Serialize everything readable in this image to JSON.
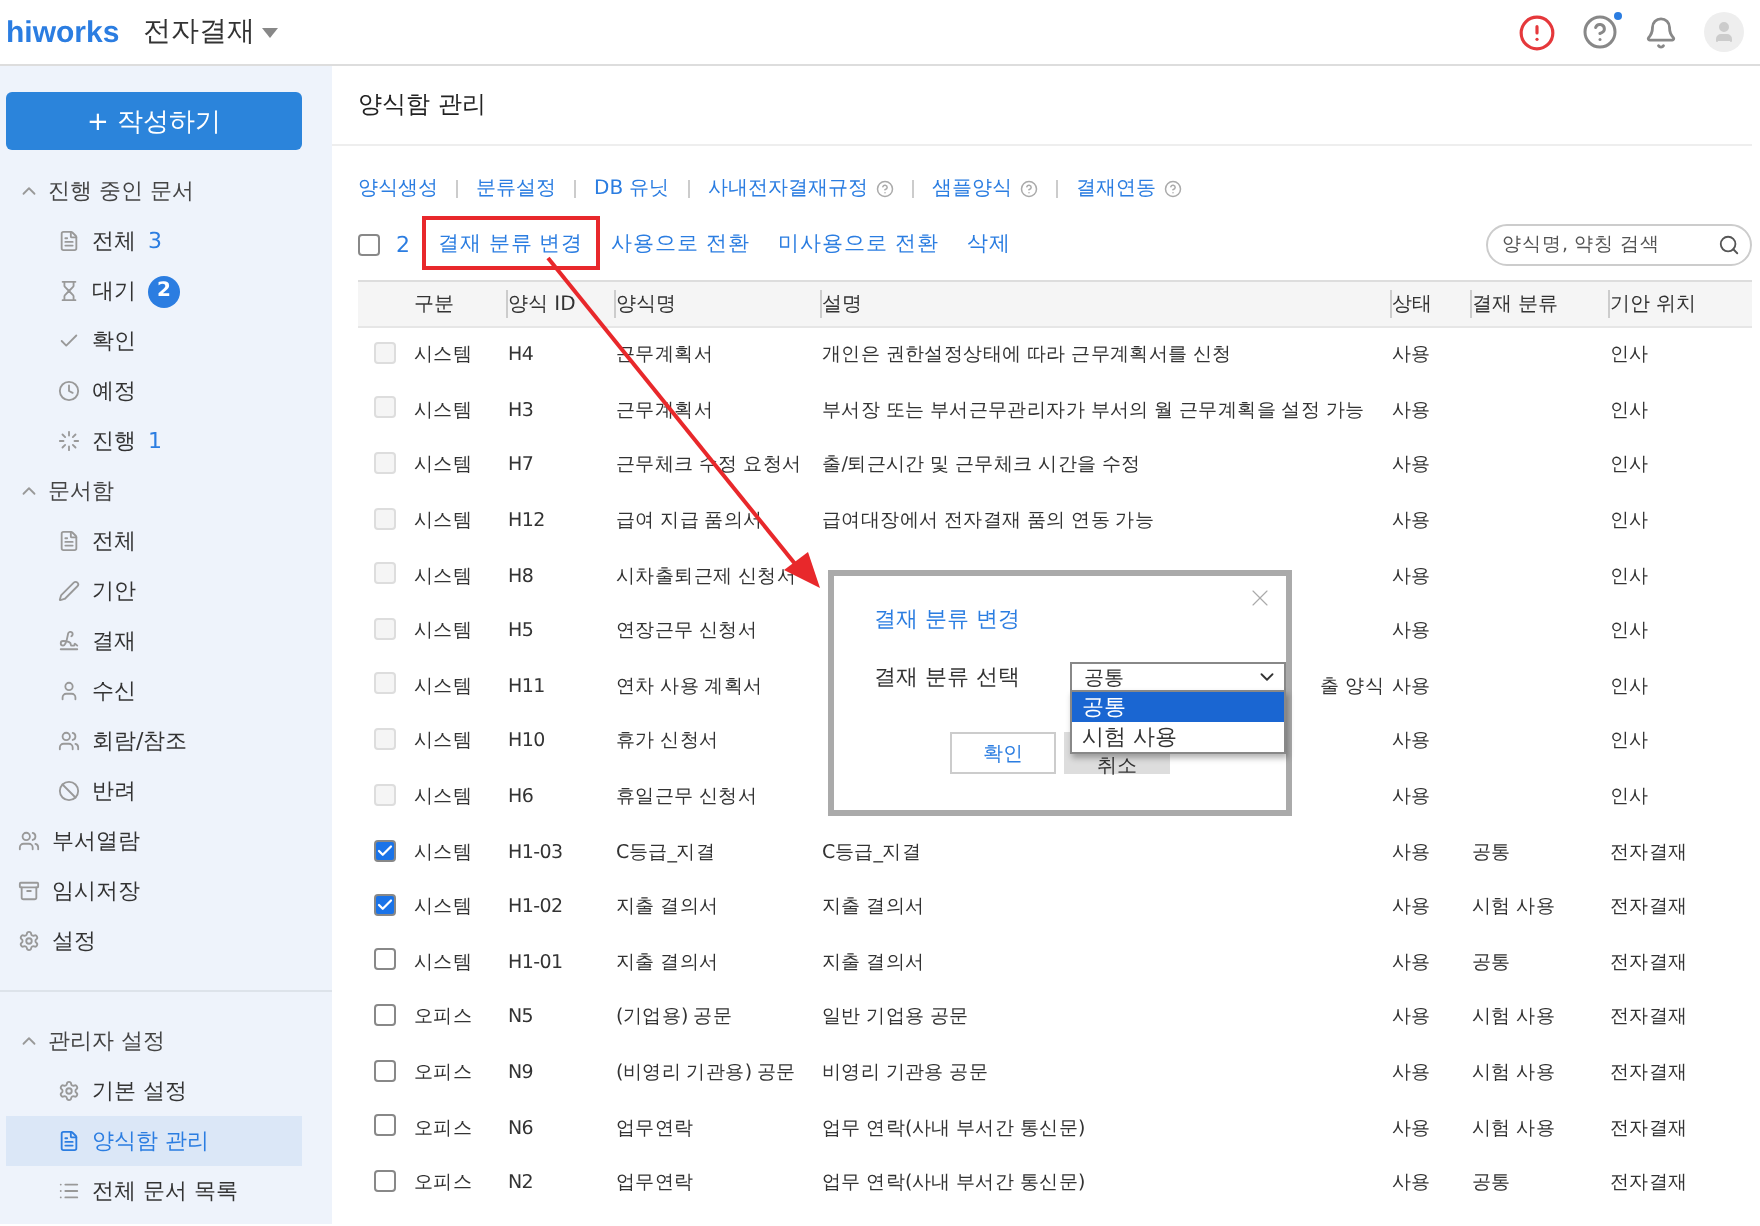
{
  "header": {
    "logo": "hiworks",
    "app_title": "전자결재"
  },
  "sidebar": {
    "compose_button": "+ 작성하기",
    "sections": [
      {
        "kind": "group",
        "label": "진행 중인 문서",
        "expanded": true,
        "children": [
          {
            "label": "전체",
            "count": "3",
            "selected": false
          },
          {
            "label": "대기",
            "badge": "2",
            "selected": false
          },
          {
            "label": "확인",
            "selected": false
          },
          {
            "label": "예정",
            "selected": false
          },
          {
            "label": "진행",
            "count": "1",
            "selected": false
          }
        ]
      },
      {
        "kind": "group",
        "label": "문서함",
        "expanded": true,
        "children": [
          {
            "label": "전체",
            "selected": false
          },
          {
            "label": "기안",
            "selected": false
          },
          {
            "label": "결재",
            "selected": false
          },
          {
            "label": "수신",
            "selected": false
          },
          {
            "label": "회람/참조",
            "selected": false
          },
          {
            "label": "반려",
            "selected": false
          }
        ]
      },
      {
        "kind": "item",
        "label": "부서열람",
        "selected": false
      },
      {
        "kind": "item",
        "label": "임시저장",
        "selected": false
      },
      {
        "kind": "item",
        "label": "설정",
        "selected": false
      },
      {
        "kind": "divider"
      },
      {
        "kind": "group",
        "label": "관리자 설정",
        "expanded": true,
        "children": [
          {
            "label": "기본 설정",
            "selected": false
          },
          {
            "label": "양식함 관리",
            "selected": true
          },
          {
            "label": "전체 문서 목록",
            "selected": false
          }
        ]
      }
    ]
  },
  "page_title": "양식함 관리",
  "links": [
    {
      "label": "양식생성",
      "help": false
    },
    {
      "label": "분류설정",
      "help": false
    },
    {
      "label": "DB 유닛",
      "help": false
    },
    {
      "label": "사내전자결재규정",
      "help": true
    },
    {
      "label": "샘플양식",
      "help": true
    },
    {
      "label": "결재연동",
      "help": true
    }
  ],
  "actions": {
    "select_all_checked": false,
    "selected_count": "2",
    "buttons": [
      "결재 분류 변경",
      "사용으로 전환",
      "미사용으로 전환",
      "삭제"
    ],
    "search_placeholder": "양식명, 약칭 검색"
  },
  "table": {
    "columns": [
      "구분",
      "양식 ID",
      "양식명",
      "설명",
      "상태",
      "결재 분류",
      "기안 위치"
    ],
    "rows": [
      {
        "type": "시스템",
        "id": "H4",
        "name": "근무계획서",
        "description": "개인은 권한설정상태에 따라 근무계획서를 신청",
        "status": "사용",
        "category": "",
        "location": "인사",
        "checked": false,
        "disabled": true
      },
      {
        "type": "시스템",
        "id": "H3",
        "name": "근무계획서",
        "description": "부서장 또는 부서근무관리자가 부서의 월 근무계획을 설정 가능",
        "status": "사용",
        "category": "",
        "location": "인사",
        "checked": false,
        "disabled": true
      },
      {
        "type": "시스템",
        "id": "H7",
        "name": "근무체크 수정 요청서",
        "description": "출/퇴근시간 및 근무체크 시간을 수정",
        "status": "사용",
        "category": "",
        "location": "인사",
        "checked": false,
        "disabled": true
      },
      {
        "type": "시스템",
        "id": "H12",
        "name": "급여 지급 품의서",
        "description": "급여대장에서 전자결재 품의 연동 가능",
        "status": "사용",
        "category": "",
        "location": "인사",
        "checked": false,
        "disabled": true
      },
      {
        "type": "시스템",
        "id": "H8",
        "name": "시차출퇴근제 신청서",
        "description": "",
        "status": "사용",
        "category": "",
        "location": "인사",
        "checked": false,
        "disabled": true
      },
      {
        "type": "시스템",
        "id": "H5",
        "name": "연장근무 신청서",
        "description": "",
        "status": "사용",
        "category": "",
        "location": "인사",
        "checked": false,
        "disabled": true
      },
      {
        "type": "시스템",
        "id": "H11",
        "name": "연차 사용 계획서",
        "description": "출 양식",
        "covered": true,
        "status": "사용",
        "category": "",
        "location": "인사",
        "checked": false,
        "disabled": true
      },
      {
        "type": "시스템",
        "id": "H10",
        "name": "휴가 신청서",
        "description": "",
        "status": "사용",
        "category": "",
        "location": "인사",
        "checked": false,
        "disabled": true
      },
      {
        "type": "시스템",
        "id": "H6",
        "name": "휴일근무 신청서",
        "description": "",
        "status": "사용",
        "category": "",
        "location": "인사",
        "checked": false,
        "disabled": true
      },
      {
        "type": "시스템",
        "id": "H1-03",
        "name": "C등급_지결",
        "description": "C등급_지결",
        "status": "사용",
        "category": "공통",
        "location": "전자결재",
        "checked": true,
        "disabled": false
      },
      {
        "type": "시스템",
        "id": "H1-02",
        "name": "지출 결의서",
        "description": "지출 결의서",
        "status": "사용",
        "category": "시험 사용",
        "location": "전자결재",
        "checked": true,
        "disabled": false
      },
      {
        "type": "시스템",
        "id": "H1-01",
        "name": "지출 결의서",
        "description": "지출 결의서",
        "status": "사용",
        "category": "공통",
        "location": "전자결재",
        "checked": false,
        "disabled": false
      },
      {
        "type": "오피스",
        "id": "N5",
        "name": "(기업용) 공문",
        "description": "일반 기업용 공문",
        "status": "사용",
        "category": "시험 사용",
        "location": "전자결재",
        "checked": false,
        "disabled": false
      },
      {
        "type": "오피스",
        "id": "N9",
        "name": "(비영리 기관용) 공문",
        "description": "비영리 기관용 공문",
        "status": "사용",
        "category": "시험 사용",
        "location": "전자결재",
        "checked": false,
        "disabled": false
      },
      {
        "type": "오피스",
        "id": "N6",
        "name": "업무연락",
        "description": "업무 연락(사내 부서간 통신문)",
        "status": "사용",
        "category": "시험 사용",
        "location": "전자결재",
        "checked": false,
        "disabled": false
      },
      {
        "type": "오피스",
        "id": "N2",
        "name": "업무연락",
        "description": "업무 연락(사내 부서간 통신문)",
        "status": "사용",
        "category": "공통",
        "location": "전자결재",
        "checked": false,
        "disabled": false
      }
    ]
  },
  "dialog": {
    "title": "결재 분류 변경",
    "field_label": "결재 분류 선택",
    "select_value": "공통",
    "options": [
      {
        "label": "공통",
        "selected": true
      },
      {
        "label": "시험 사용",
        "selected": false
      }
    ],
    "buttons": [
      "확인",
      "취소"
    ]
  }
}
